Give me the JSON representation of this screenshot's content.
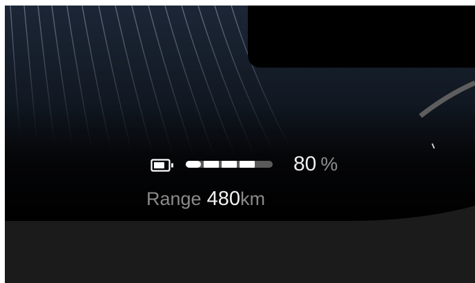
{
  "battery": {
    "percent_value": "80",
    "percent_unit": "%",
    "charge_fraction": 0.8,
    "bar_color": "#ffffff",
    "track_color": "#5a5a5a"
  },
  "range": {
    "label": "Range",
    "value": "480",
    "unit": "km"
  },
  "icons": {
    "battery": "battery-icon"
  },
  "colors": {
    "background": "#000000",
    "lower_panel": "#1b1b1b",
    "display_gradient": "#1a2230"
  }
}
